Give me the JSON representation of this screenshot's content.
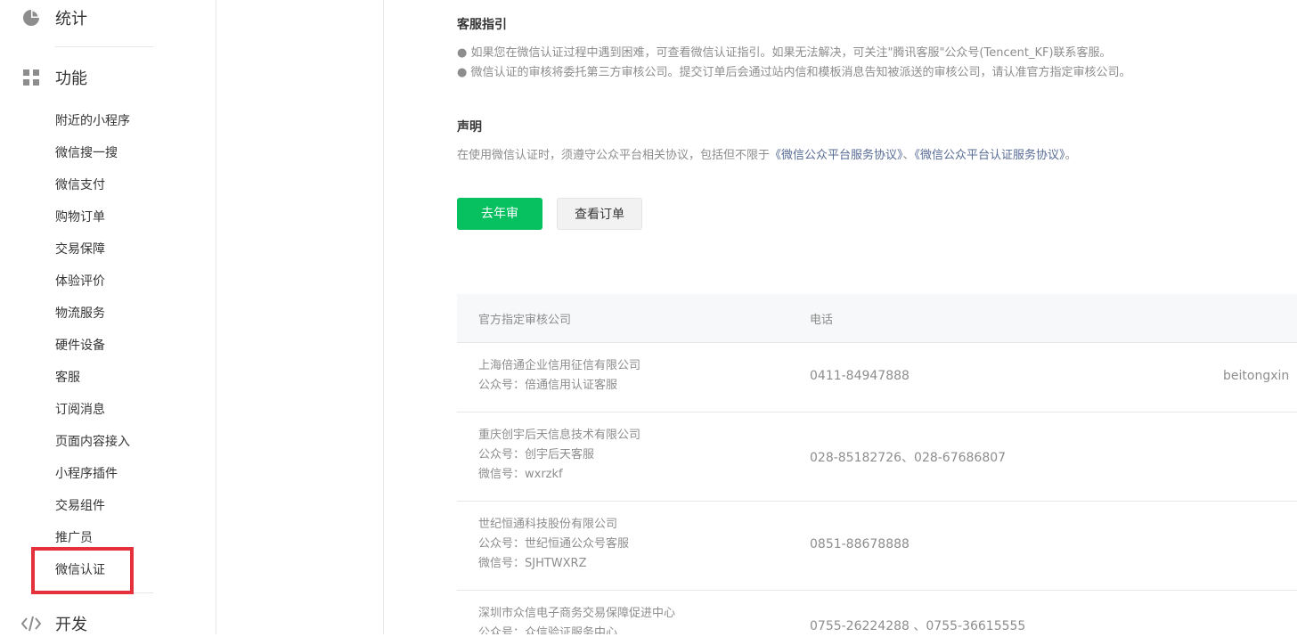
{
  "sidebar": {
    "stats": {
      "label": "统计",
      "icon": "pie-chart-icon"
    },
    "features": {
      "label": "功能",
      "icon": "grid-icon"
    },
    "items": [
      "附近的小程序",
      "微信搜一搜",
      "微信支付",
      "购物订单",
      "交易保障",
      "体验评价",
      "物流服务",
      "硬件设备",
      "客服",
      "订阅消息",
      "页面内容接入",
      "小程序插件",
      "交易组件",
      "推广员",
      "微信认证"
    ],
    "dev": {
      "label": "开发",
      "icon": "code-icon"
    }
  },
  "main": {
    "guide": {
      "title": "客服指引",
      "line1": "● 如果您在微信认证过程中遇到困难，可查看微信认证指引。如果无法解决，可关注\"腾讯客服\"公众号(Tencent_KF)联系客服。",
      "line2": "● 微信认证的审核将委托第三方审核公司。提交订单后会通过站内信和模板消息告知被派送的审核公司，请认准官方指定审核公司。"
    },
    "statement": {
      "title": "声明",
      "prefix": "在使用微信认证时，须遵守公众平台相关协议，包括但不限于",
      "link1": "《微信公众平台服务协议》",
      "sep": "、",
      "link2": "《微信公众平台认证服务协议》",
      "suffix": "。"
    },
    "buttons": {
      "primary": "去年审",
      "secondary": "查看订单"
    },
    "table": {
      "headers": {
        "company": "官方指定审核公司",
        "phone": "电话"
      },
      "rows": [
        {
          "name": "上海倍通企业信用征信有限公司",
          "account": "公众号：倍通信用认证客服",
          "phone": "0411-84947888",
          "extra": "beitongxin"
        },
        {
          "name": "重庆创宇后天信息技术有限公司",
          "account": "公众号：创宇后天客服",
          "wechat": "微信号：wxrzkf",
          "phone": "028-85182726、028-67686807"
        },
        {
          "name": "世纪恒通科技股份有限公司",
          "account": "公众号：世纪恒通公众号客服",
          "wechat": "微信号：SJHTWXRZ",
          "phone": "0851-88678888"
        },
        {
          "name": "深圳市众信电子商务交易保障促进中心",
          "account": "公众号：众信验证服务中心",
          "phone": "0755-26224288 、0755-36615555"
        }
      ]
    }
  },
  "colors": {
    "primary": "#07c160",
    "link": "#576b95",
    "highlight": "#e5313b"
  }
}
